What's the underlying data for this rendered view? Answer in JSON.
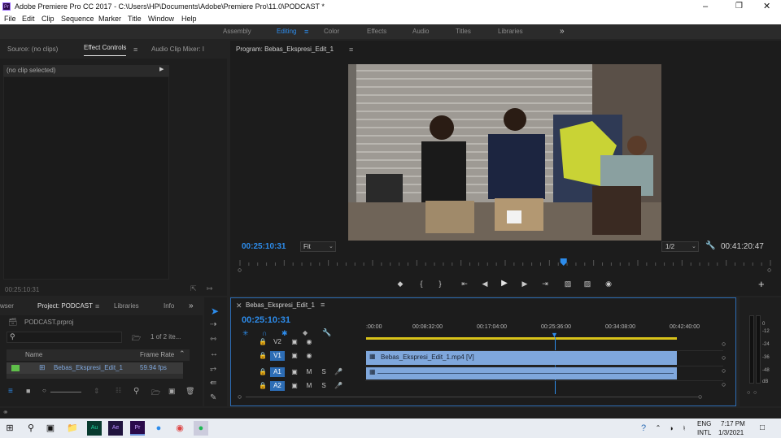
{
  "window": {
    "title": "Adobe Premiere Pro CC 2017 - C:\\Users\\HP\\Documents\\Adobe\\Premiere Pro\\11.0\\PODCAST *",
    "app_badge": "Pr"
  },
  "menu": [
    "File",
    "Edit",
    "Clip",
    "Sequence",
    "Marker",
    "Title",
    "Window",
    "Help"
  ],
  "workspaces": {
    "items": [
      "Assembly",
      "Editing",
      "Color",
      "Effects",
      "Audio",
      "Titles",
      "Libraries"
    ],
    "active": "Editing",
    "more": "»"
  },
  "left_panel": {
    "tabs": [
      "Source: (no clips)",
      "Effect Controls",
      "Audio Clip Mixer: I"
    ],
    "active": "Effect Controls",
    "menu_icon": "≡",
    "no_clip": "(no clip selected)",
    "timecode": "00:25:10:31"
  },
  "program": {
    "title": "Program: Bebas_Ekspresi_Edit_1",
    "timecode": "00:25:10:31",
    "fit": "Fit",
    "resolution": "1/2",
    "duration": "00:41:20:47",
    "playhead_fraction": 0.61
  },
  "project": {
    "tabs": [
      "wser",
      "Project: PODCAST",
      "Libraries",
      "Info"
    ],
    "active": "Project: PODCAST",
    "file": "PODCAST.prproj",
    "items_count": "1 of 2 ite...",
    "col_name": "Name",
    "col_rate": "Frame Rate",
    "item_name": "Bebas_Ekspresi_Edit_1",
    "item_rate": "59.94 fps"
  },
  "timeline": {
    "sequence": "Bebas_Ekspresi_Edit_1",
    "timecode": "00:25:10:31",
    "ruler": [
      ":00:00",
      "00:08:32:00",
      "00:17:04:00",
      "00:25:36:00",
      "00:34:08:00",
      "00:42:40:00"
    ],
    "tracks": [
      {
        "id": "V2",
        "label": "V2"
      },
      {
        "id": "V1",
        "label": "V1"
      },
      {
        "id": "A1",
        "label": "A1"
      },
      {
        "id": "A2",
        "label": "A2"
      }
    ],
    "video_clip": "Bebas_Ekspresi_Edit_1.mp4 [V]",
    "m_label": "M",
    "s_label": "S"
  },
  "meter": {
    "ticks": [
      "0",
      "-12",
      "-24",
      "-36",
      "-48",
      "dB"
    ]
  },
  "taskbar": {
    "lang_top": "ENG",
    "lang_bottom": "INTL",
    "time": "7:17 PM",
    "date": "1/3/2021"
  },
  "colors": {
    "accent": "#2d8ceb",
    "clip": "#7fa7dc",
    "panel_bg": "#1e1e1e"
  }
}
